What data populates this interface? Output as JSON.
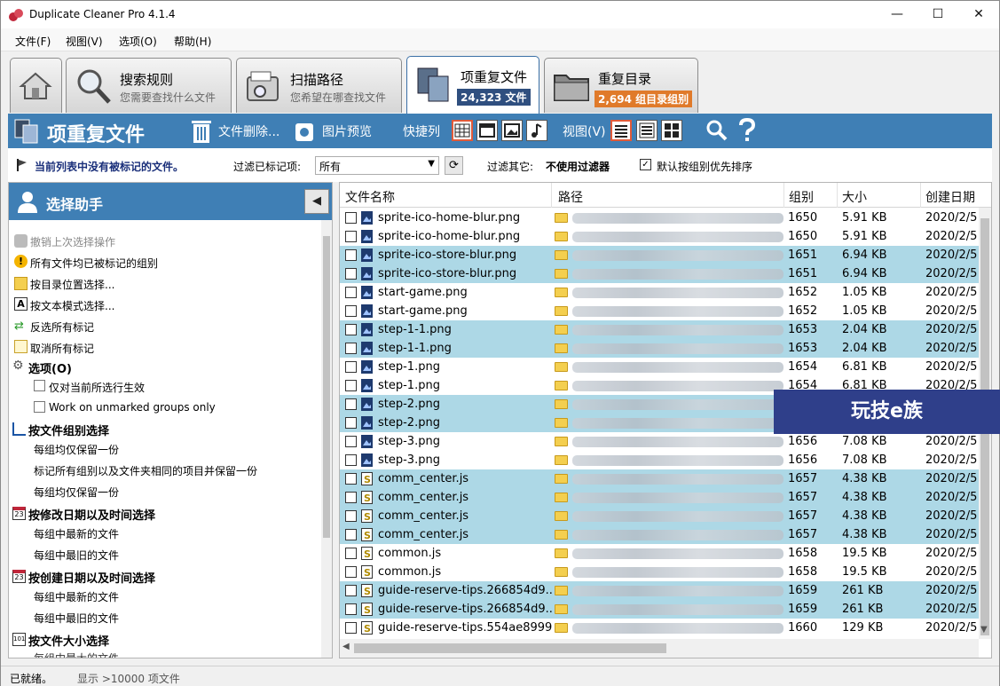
{
  "window": {
    "title": "Duplicate Cleaner Pro 4.1.4",
    "minimize": "—",
    "maximize": "☐",
    "close": "✕"
  },
  "menu": [
    "文件(F)",
    "视图(V)",
    "选项(O)",
    "帮助(H)"
  ],
  "tabs": [
    {
      "title": "搜索规则",
      "subtitle": "您需要查找什么文件"
    },
    {
      "title": "扫描路径",
      "subtitle": "您希望在哪查找文件"
    },
    {
      "title": "项重复文件",
      "badge": "24,323 文件",
      "badge_color": "#2f4f7f"
    },
    {
      "title": "重复目录",
      "badge": "2,694 组目录组别",
      "badge_color": "#e07a2a"
    }
  ],
  "toolbar": {
    "title": "项重复文件",
    "delete_label": "文件删除...",
    "preview_label": "图片预览",
    "shortcut_label": "快捷列",
    "view_label": "视图(V)"
  },
  "filterbar": {
    "no_marked": "当前列表中没有被标记的文件。",
    "filter_marked_label": "过滤已标记项:",
    "filter_marked_value": "所有",
    "filter_other_label": "过滤其它:",
    "filter_other_value": "不使用过滤器",
    "sort_label": "默认按组别优先排序",
    "sort_checked": "✓"
  },
  "assistant": {
    "title": "选择助手",
    "items": {
      "undo": "撤销上次选择操作",
      "all_marked": "所有文件均已被标记的组别",
      "by_folder": "按目录位置选择...",
      "by_text": "按文本模式选择...",
      "invert": "反选所有标记",
      "clear": "取消所有标记",
      "options": "选项(O)",
      "only_current": "仅对当前所选行生效",
      "unmarked_only": "Work on unmarked groups only",
      "by_group": "按文件组别选择",
      "keep_one_1": "每组均仅保留一份",
      "mark_same_folder": "标记所有组别以及文件夹相同的项目并保留一份",
      "keep_one_2": "每组均仅保留一份",
      "by_modified": "按修改日期以及时间选择",
      "mod_newest": "每组中最新的文件",
      "mod_oldest": "每组中最旧的文件",
      "by_created": "按创建日期以及时间选择",
      "cre_newest": "每组中最新的文件",
      "cre_oldest": "每组中最旧的文件",
      "by_size": "按文件大小选择",
      "size_largest": "每组中最大的文件"
    }
  },
  "table": {
    "columns": [
      "文件名称",
      "路径",
      "组别",
      "大小",
      "创建日期"
    ],
    "rows": [
      {
        "name": "sprite-ico-home-blur.png",
        "group": "1650",
        "size": "5.91 KB",
        "date": "2020/2/5",
        "type": "png",
        "hl": false
      },
      {
        "name": "sprite-ico-home-blur.png",
        "group": "1650",
        "size": "5.91 KB",
        "date": "2020/2/5",
        "type": "png",
        "hl": false
      },
      {
        "name": "sprite-ico-store-blur.png",
        "group": "1651",
        "size": "6.94 KB",
        "date": "2020/2/5",
        "type": "png",
        "hl": true
      },
      {
        "name": "sprite-ico-store-blur.png",
        "group": "1651",
        "size": "6.94 KB",
        "date": "2020/2/5",
        "type": "png",
        "hl": true
      },
      {
        "name": "start-game.png",
        "group": "1652",
        "size": "1.05 KB",
        "date": "2020/2/5",
        "type": "png",
        "hl": false
      },
      {
        "name": "start-game.png",
        "group": "1652",
        "size": "1.05 KB",
        "date": "2020/2/5",
        "type": "png",
        "hl": false
      },
      {
        "name": "step-1-1.png",
        "group": "1653",
        "size": "2.04 KB",
        "date": "2020/2/5",
        "type": "png",
        "hl": true
      },
      {
        "name": "step-1-1.png",
        "group": "1653",
        "size": "2.04 KB",
        "date": "2020/2/5",
        "type": "png",
        "hl": true
      },
      {
        "name": "step-1.png",
        "group": "1654",
        "size": "6.81 KB",
        "date": "2020/2/5",
        "type": "png",
        "hl": false
      },
      {
        "name": "step-1.png",
        "group": "1654",
        "size": "6.81 KB",
        "date": "2020/2/5",
        "type": "png",
        "hl": false
      },
      {
        "name": "step-2.png",
        "group": "",
        "size": "",
        "date": "",
        "type": "png",
        "hl": true
      },
      {
        "name": "step-2.png",
        "group": "",
        "size": "",
        "date": "",
        "type": "png",
        "hl": true
      },
      {
        "name": "step-3.png",
        "group": "1656",
        "size": "7.08 KB",
        "date": "2020/2/5",
        "type": "png",
        "hl": false
      },
      {
        "name": "step-3.png",
        "group": "1656",
        "size": "7.08 KB",
        "date": "2020/2/5",
        "type": "png",
        "hl": false
      },
      {
        "name": "comm_center.js",
        "group": "1657",
        "size": "4.38 KB",
        "date": "2020/2/5",
        "type": "js",
        "hl": true
      },
      {
        "name": "comm_center.js",
        "group": "1657",
        "size": "4.38 KB",
        "date": "2020/2/5",
        "type": "js",
        "hl": true
      },
      {
        "name": "comm_center.js",
        "group": "1657",
        "size": "4.38 KB",
        "date": "2020/2/5",
        "type": "js",
        "hl": true
      },
      {
        "name": "comm_center.js",
        "group": "1657",
        "size": "4.38 KB",
        "date": "2020/2/5",
        "type": "js",
        "hl": true
      },
      {
        "name": "common.js",
        "group": "1658",
        "size": "19.5 KB",
        "date": "2020/2/5",
        "type": "js",
        "hl": false
      },
      {
        "name": "common.js",
        "group": "1658",
        "size": "19.5 KB",
        "date": "2020/2/5",
        "type": "js",
        "hl": false
      },
      {
        "name": "guide-reserve-tips.266854d9...",
        "group": "1659",
        "size": "261 KB",
        "date": "2020/2/5",
        "type": "js",
        "hl": true
      },
      {
        "name": "guide-reserve-tips.266854d9...",
        "group": "1659",
        "size": "261 KB",
        "date": "2020/2/5",
        "type": "js",
        "hl": true
      },
      {
        "name": "guide-reserve-tips.554ae8999...",
        "group": "1660",
        "size": "129 KB",
        "date": "2020/2/5",
        "type": "js",
        "hl": false
      }
    ]
  },
  "watermark": "玩技e族",
  "status": {
    "ready": "已就绪。",
    "shown": "显示 >10000 项文件"
  }
}
